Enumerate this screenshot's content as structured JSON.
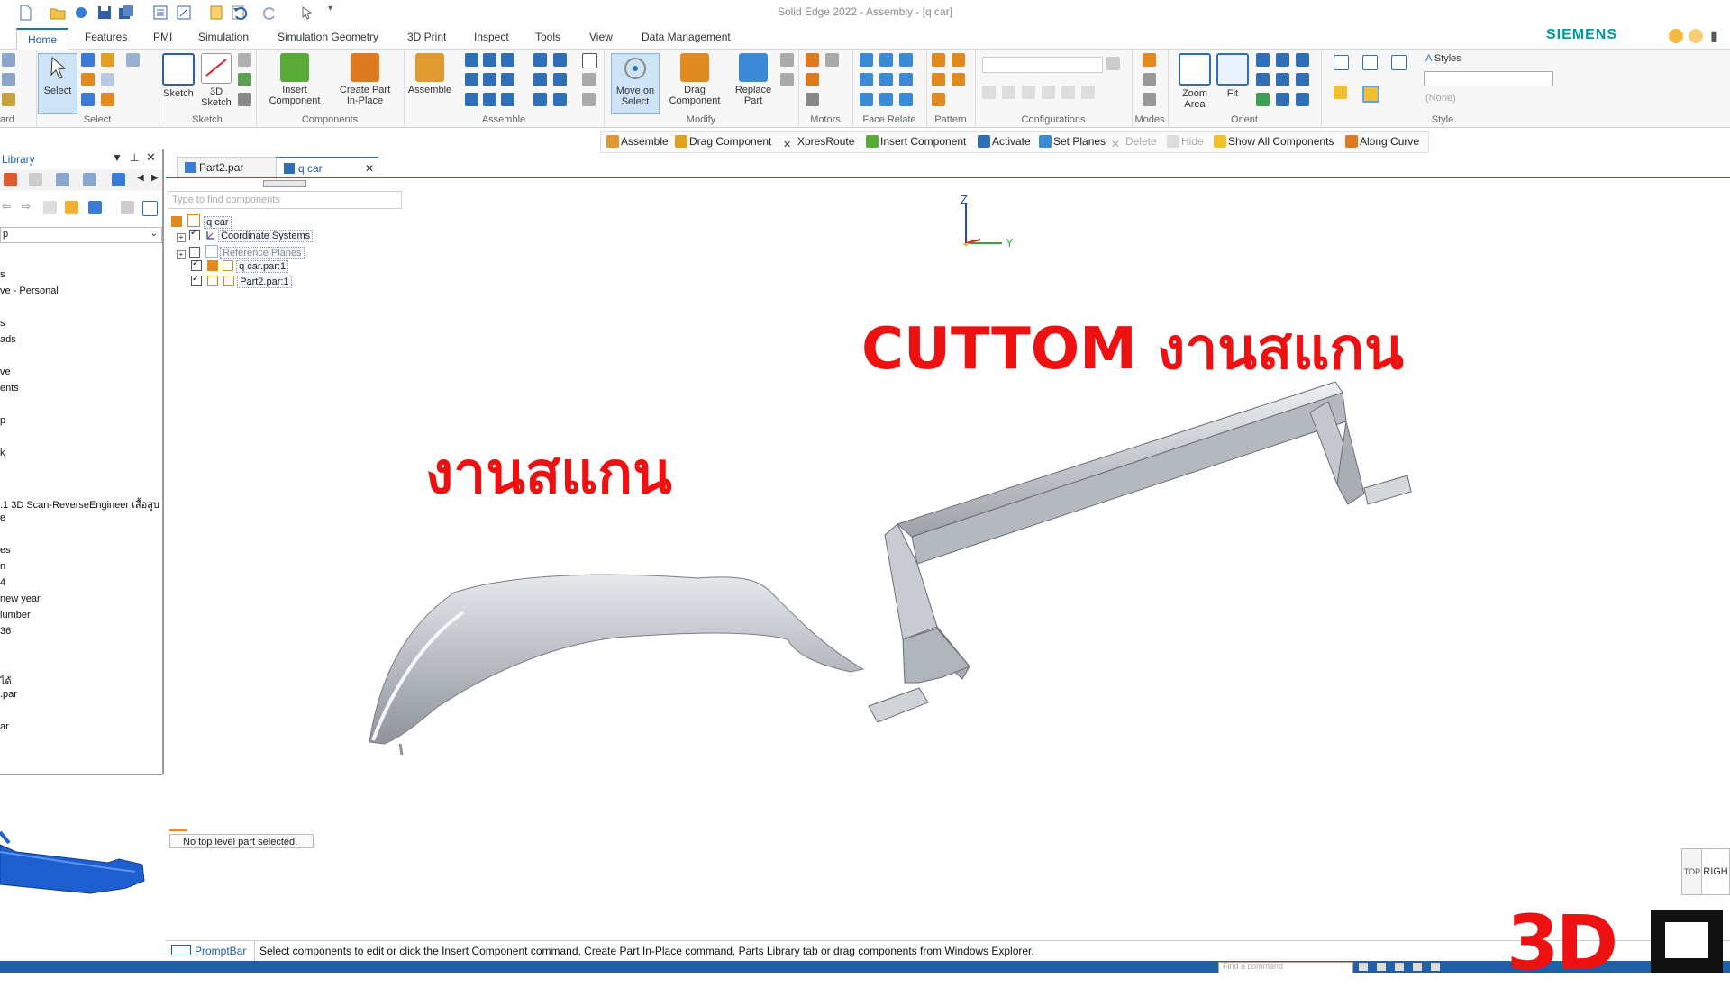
{
  "window": {
    "title": "Solid Edge 2022 - Assembly - [q car]",
    "brand": "SIEMENS"
  },
  "tabs": [
    "Home",
    "Features",
    "PMI",
    "Simulation",
    "Simulation Geometry",
    "3D Print",
    "Inspect",
    "Tools",
    "View",
    "Data Management"
  ],
  "ribbon": {
    "groups": {
      "clipboard": "ard",
      "select": "Select",
      "sketch": "Sketch",
      "components": "Components",
      "assemble": "Assemble",
      "modify": "Modify",
      "motors": "Motors",
      "face_relate": "Face Relate",
      "pattern": "Pattern",
      "configurations": "Configurations",
      "modes": "Modes",
      "orient": "Orient",
      "style": "Style"
    },
    "buttons": {
      "select": "Select",
      "sketch": "Sketch",
      "sketch3d_1": "3D",
      "sketch3d_2": "Sketch",
      "insert_component_1": "Insert",
      "insert_component_2": "Component",
      "create_part_1": "Create Part",
      "create_part_2": "In-Place",
      "assemble": "Assemble",
      "move_on_select_1": "Move on",
      "move_on_select_2": "Select",
      "drag_component_1": "Drag",
      "drag_component_2": "Component",
      "replace_part_1": "Replace",
      "replace_part_2": "Part",
      "zoom_area_1": "Zoom",
      "zoom_area_2": "Area",
      "fit": "Fit",
      "styles": "Styles",
      "style_none": "(None)"
    }
  },
  "command_bar": [
    "Assemble",
    "Drag Component",
    "XpresRoute",
    "Insert Component",
    "Activate",
    "Set Planes",
    "Delete",
    "Hide",
    "Show All Components",
    "Along Curve"
  ],
  "library": {
    "title": "Library",
    "dropdown": "p",
    "items": [
      "s",
      "ve - Personal",
      "s",
      "ads",
      "ve",
      "ents",
      "p",
      "k",
      ".1 3D Scan-ReverseEngineer เสื้อสูบ",
      "e",
      "es",
      "n",
      "4",
      "new year",
      "lumber",
      "36",
      "ได้",
      ".par",
      "ar"
    ]
  },
  "doc_tabs": [
    "Part2.par",
    "q car"
  ],
  "pathfinder": {
    "search_placeholder": "Type to find components",
    "root": "q car",
    "nodes": [
      "Coordinate Systems",
      "Reference Planes",
      "q car.par:1",
      "Part2.par:1"
    ],
    "status": "No top level part selected."
  },
  "viewport": {
    "label_scan": "งานสแกน",
    "label_custom": "CUTTOM งานสแกน",
    "axis_z": "Z",
    "axis_y": "Y",
    "viewcube_right": "RIGH",
    "viewcube_left": "TOP",
    "label_color": "#ee1111"
  },
  "prompt": {
    "label": "PromptBar",
    "text": "Select components to edit or click the Insert Component command, Create Part In-Place command, Parts Library tab or drag components from Windows Explorer.",
    "find_placeholder": "Find a command"
  },
  "watermark": "3D"
}
